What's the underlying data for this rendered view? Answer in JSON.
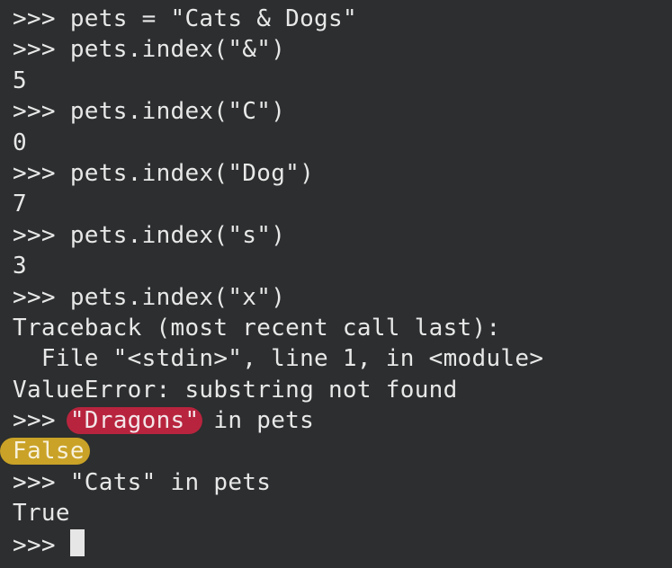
{
  "terminal": {
    "prompt": ">>>",
    "lines": [
      {
        "kind": "input",
        "text": "pets = \"Cats & Dogs\""
      },
      {
        "kind": "input",
        "text": "pets.index(\"&\")"
      },
      {
        "kind": "output",
        "text": "5"
      },
      {
        "kind": "input",
        "text": "pets.index(\"C\")"
      },
      {
        "kind": "output",
        "text": "0"
      },
      {
        "kind": "input",
        "text": "pets.index(\"Dog\")"
      },
      {
        "kind": "output",
        "text": "7"
      },
      {
        "kind": "input",
        "text": "pets.index(\"s\")"
      },
      {
        "kind": "output",
        "text": "3"
      },
      {
        "kind": "input",
        "text": "pets.index(\"x\")"
      },
      {
        "kind": "output",
        "text": "Traceback (most recent call last):"
      },
      {
        "kind": "output",
        "text": "  File \"<stdin>\", line 1, in <module>"
      },
      {
        "kind": "output",
        "text": "ValueError: substring not found"
      }
    ],
    "highlighted_input": {
      "highlight": "\"Dragons\"",
      "rest": " in pets"
    },
    "highlighted_output": "False",
    "after_lines": [
      {
        "kind": "input",
        "text": "\"Cats\" in pets"
      },
      {
        "kind": "output",
        "text": "True"
      }
    ]
  },
  "colors": {
    "background": "#2c2e2f",
    "text": "#e8e8e8",
    "highlight_red": "#b8243e",
    "highlight_yellow": "#c9a227"
  }
}
